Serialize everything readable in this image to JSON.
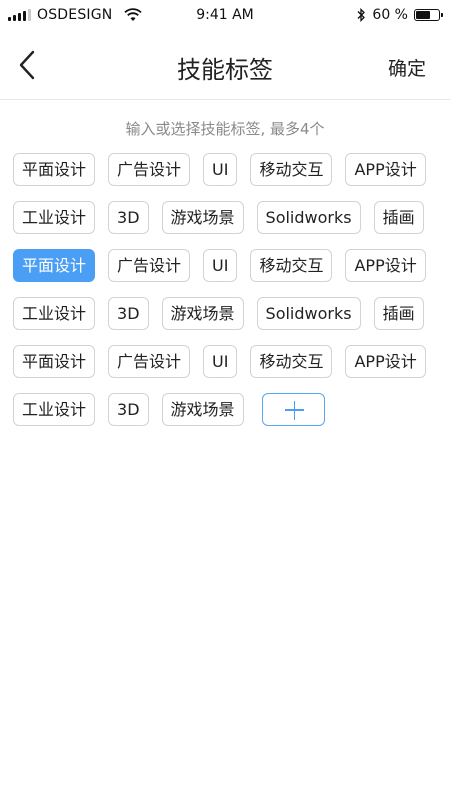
{
  "status_bar": {
    "carrier": "OSDESIGN",
    "time": "9:41 AM",
    "battery": "60 %"
  },
  "nav": {
    "title": "技能标签",
    "confirm": "确定"
  },
  "hint": "输入或选择技能标签, 最多4个",
  "tag_rows": [
    [
      "平面设计",
      "广告设计",
      "UI",
      "移动交互",
      "APP设计"
    ],
    [
      "工业设计",
      "3D",
      "游戏场景",
      "Solidworks",
      "插画"
    ],
    [
      "平面设计",
      "广告设计",
      "UI",
      "移动交互",
      "APP设计"
    ],
    [
      "工业设计",
      "3D",
      "游戏场景",
      "Solidworks",
      "插画"
    ],
    [
      "平面设计",
      "广告设计",
      "UI",
      "移动交互",
      "APP设计"
    ],
    [
      "工业设计",
      "3D",
      "游戏场景"
    ]
  ],
  "selected": {
    "row": 2,
    "index": 0
  },
  "accent_color": "#4a9ff5"
}
